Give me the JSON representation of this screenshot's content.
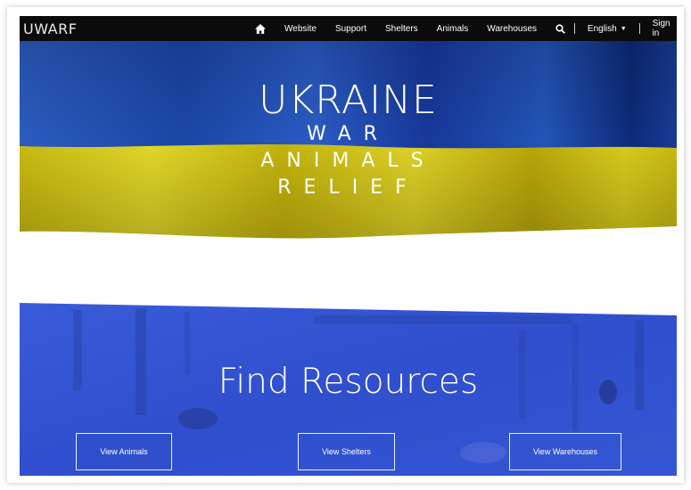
{
  "navbar": {
    "brand": "UWARF",
    "items": [
      "Website",
      "Support",
      "Shelters",
      "Animals",
      "Warehouses"
    ],
    "language": "English",
    "signin": "Sign in",
    "icons": [
      "home-icon",
      "search-icon",
      "caret-down-icon"
    ]
  },
  "hero": {
    "title": "UKRAINE",
    "line1": "WAR",
    "line2": "ANIMALS",
    "line3": "RELIEF",
    "colors": {
      "blue": "#1d4fb0",
      "yellow": "#d2c414"
    }
  },
  "resources": {
    "title": "Find Resources",
    "buttons": [
      "View Animals",
      "View Shelters",
      "View Warehouses"
    ],
    "overlay_color": "#3558d6"
  }
}
